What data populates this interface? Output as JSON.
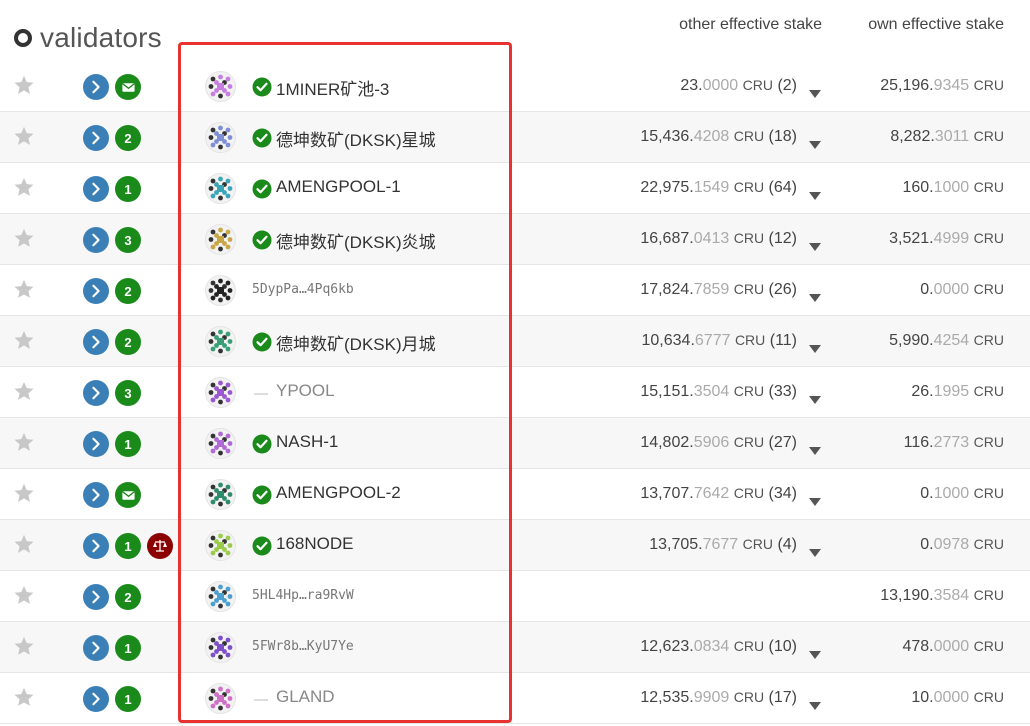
{
  "header": {
    "title": "validators",
    "col_other": "other effective stake",
    "col_own": "own effective stake"
  },
  "colors": {
    "nav": "#3b7fb7",
    "badge": "#1a8a1a",
    "slashed": "#8b0000",
    "highlight": "#e8322f",
    "verified": "#1a8a1a"
  },
  "rows": [
    {
      "badge": "mail",
      "slashed": false,
      "identicon": "#c77ee0",
      "verified": true,
      "name": "1MINER矿池-3",
      "is_address": false,
      "other_int": "23.",
      "other_dec": "0000",
      "other_unit": "CRU",
      "other_count": "(2)",
      "has_caret": true,
      "own_int": "25,196.",
      "own_dec": "9345",
      "own_unit": "CRU"
    },
    {
      "badge": "2",
      "slashed": false,
      "identicon": "#7f8fd6",
      "verified": true,
      "name": "德坤数矿(DKSK)星城",
      "is_address": false,
      "other_int": "15,436.",
      "other_dec": "4208",
      "other_unit": "CRU",
      "other_count": "(18)",
      "has_caret": true,
      "own_int": "8,282.",
      "own_dec": "3011",
      "own_unit": "CRU"
    },
    {
      "badge": "1",
      "slashed": false,
      "identicon": "#3aa6b8",
      "verified": true,
      "name": "AMENGPOOL-1",
      "is_address": false,
      "other_int": "22,975.",
      "other_dec": "1549",
      "other_unit": "CRU",
      "other_count": "(64)",
      "has_caret": true,
      "own_int": "160.",
      "own_dec": "1000",
      "own_unit": "CRU"
    },
    {
      "badge": "3",
      "slashed": false,
      "identicon": "#c9a646",
      "verified": true,
      "name": "德坤数矿(DKSK)炎城",
      "is_address": false,
      "other_int": "16,687.",
      "other_dec": "0413",
      "other_unit": "CRU",
      "other_count": "(12)",
      "has_caret": true,
      "own_int": "3,521.",
      "own_dec": "4999",
      "own_unit": "CRU"
    },
    {
      "badge": "2",
      "slashed": false,
      "identicon": "#222222",
      "verified": false,
      "name": "5DypPa…4Pq6kb",
      "is_address": true,
      "other_int": "17,824.",
      "other_dec": "7859",
      "other_unit": "CRU",
      "other_count": "(26)",
      "has_caret": true,
      "own_int": "0.",
      "own_dec": "0000",
      "own_unit": "CRU"
    },
    {
      "badge": "2",
      "slashed": false,
      "identicon": "#3a9e76",
      "verified": true,
      "name": "德坤数矿(DKSK)月城",
      "is_address": false,
      "other_int": "10,634.",
      "other_dec": "6777",
      "other_unit": "CRU",
      "other_count": "(11)",
      "has_caret": true,
      "own_int": "5,990.",
      "own_dec": "4254",
      "own_unit": "CRU"
    },
    {
      "badge": "3",
      "slashed": false,
      "identicon": "#9b59d0",
      "verified": false,
      "name": "YPOOL",
      "is_address": false,
      "other_int": "15,151.",
      "other_dec": "3504",
      "other_unit": "CRU",
      "other_count": "(33)",
      "has_caret": true,
      "own_int": "26.",
      "own_dec": "1995",
      "own_unit": "CRU"
    },
    {
      "badge": "1",
      "slashed": false,
      "identicon": "#b06ad6",
      "verified": true,
      "name": "NASH-1",
      "is_address": false,
      "other_int": "14,802.",
      "other_dec": "5906",
      "other_unit": "CRU",
      "other_count": "(27)",
      "has_caret": true,
      "own_int": "116.",
      "own_dec": "2773",
      "own_unit": "CRU"
    },
    {
      "badge": "mail",
      "slashed": false,
      "identicon": "#2e8c6b",
      "verified": true,
      "name": "AMENGPOOL-2",
      "is_address": false,
      "other_int": "13,707.",
      "other_dec": "7642",
      "other_unit": "CRU",
      "other_count": "(34)",
      "has_caret": true,
      "own_int": "0.",
      "own_dec": "1000",
      "own_unit": "CRU"
    },
    {
      "badge": "1",
      "slashed": true,
      "identicon": "#9acb4a",
      "verified": true,
      "name": "168NODE",
      "is_address": false,
      "other_int": "13,705.",
      "other_dec": "7677",
      "other_unit": "CRU",
      "other_count": "(4)",
      "has_caret": true,
      "own_int": "0.",
      "own_dec": "0978",
      "own_unit": "CRU"
    },
    {
      "badge": "2",
      "slashed": false,
      "identicon": "#4aa0d0",
      "verified": false,
      "name": "5HL4Hp…ra9RvW",
      "is_address": true,
      "other_int": "",
      "other_dec": "",
      "other_unit": "",
      "other_count": "",
      "has_caret": false,
      "own_int": "13,190.",
      "own_dec": "3584",
      "own_unit": "CRU"
    },
    {
      "badge": "1",
      "slashed": false,
      "identicon": "#7d4fc8",
      "verified": false,
      "name": "5FWr8b…KyU7Ye",
      "is_address": true,
      "other_int": "12,623.",
      "other_dec": "0834",
      "other_unit": "CRU",
      "other_count": "(10)",
      "has_caret": true,
      "own_int": "478.",
      "own_dec": "0000",
      "own_unit": "CRU"
    },
    {
      "badge": "1",
      "slashed": false,
      "identicon": "#d070c8",
      "verified": false,
      "name": "GLAND",
      "is_address": false,
      "other_int": "12,535.",
      "other_dec": "9909",
      "other_unit": "CRU",
      "other_count": "(17)",
      "has_caret": true,
      "own_int": "10.",
      "own_dec": "0000",
      "own_unit": "CRU"
    }
  ]
}
